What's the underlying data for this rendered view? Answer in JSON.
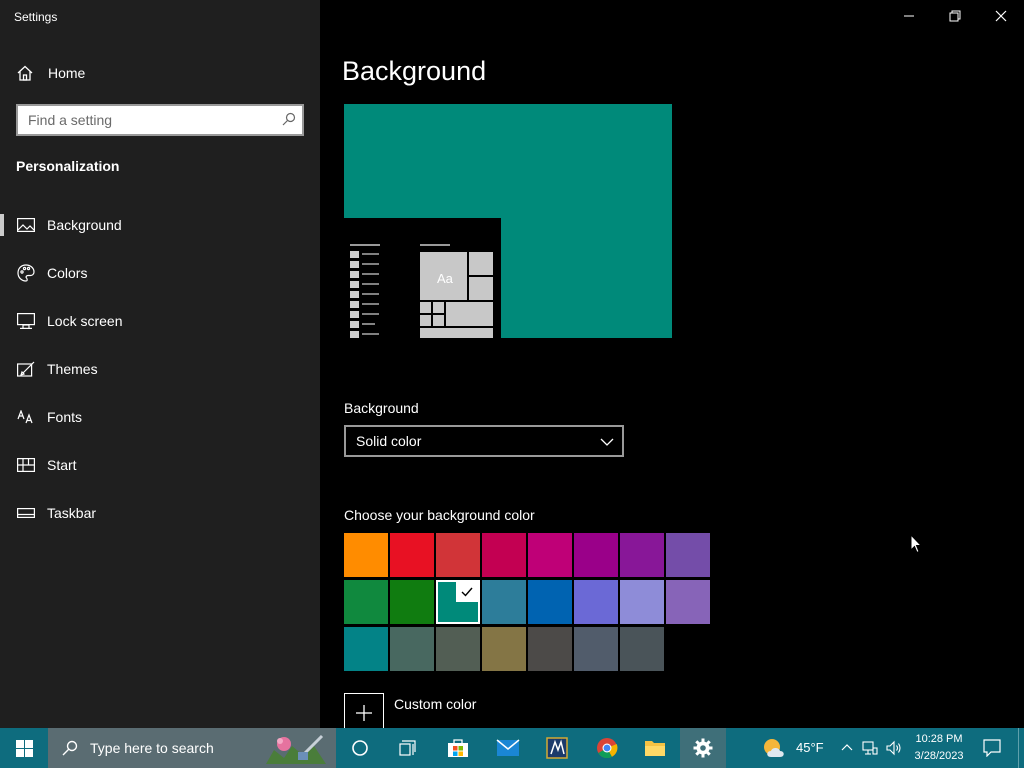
{
  "app": {
    "title": "Settings"
  },
  "sidebar": {
    "home_label": "Home",
    "search_placeholder": "Find a setting",
    "section_title": "Personalization",
    "items": [
      {
        "label": "Background",
        "icon": "picture-icon",
        "active": true
      },
      {
        "label": "Colors",
        "icon": "palette-icon"
      },
      {
        "label": "Lock screen",
        "icon": "lock-screen-icon"
      },
      {
        "label": "Themes",
        "icon": "brush-icon"
      },
      {
        "label": "Fonts",
        "icon": "font-icon"
      },
      {
        "label": "Start",
        "icon": "start-icon"
      },
      {
        "label": "Taskbar",
        "icon": "taskbar-icon"
      }
    ]
  },
  "main": {
    "title": "Background",
    "preview_tile_label": "Aa",
    "background_label": "Background",
    "background_value": "Solid color",
    "color_label": "Choose your background color",
    "colors": [
      [
        "#ff8c00",
        "#e81123",
        "#d13438",
        "#c30052",
        "#bf0077",
        "#9a0089",
        "#881798",
        "#744da9"
      ],
      [
        "#10893e",
        "#107c10",
        "#008a7a",
        "#2d7d9a",
        "#0063b1",
        "#6b69d6",
        "#8e8cd8",
        "#8764b8"
      ],
      [
        "#038387",
        "#486860",
        "#525e54",
        "#847545",
        "#4c4a48",
        "#515c6b",
        "#4a5459"
      ]
    ],
    "selected_color": "#008a7a",
    "custom_color_label": "Custom color"
  },
  "taskbar": {
    "search_text": "Type here to search",
    "temperature": "45°F",
    "time": "10:28 PM",
    "date": "3/28/2023",
    "color": "#0e6c7e"
  }
}
